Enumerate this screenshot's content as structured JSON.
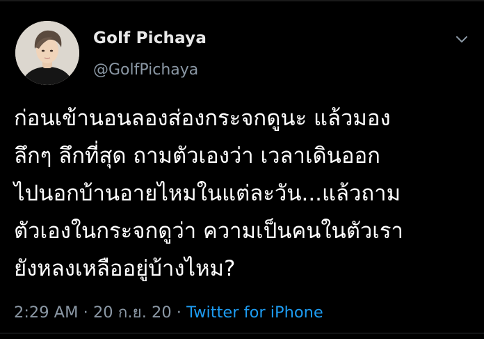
{
  "author": {
    "display_name": "Golf Pichaya",
    "handle": "@GolfPichaya",
    "avatar_icon": "profile-photo-icon"
  },
  "menu": {
    "icon": "chevron-down-icon"
  },
  "tweet": {
    "lines": [
      "ก่อนเข้านอนลองส่องกระจกดูนะ แล้วมอง",
      "ลึกๆ ลึกที่สุด ถามตัวเองว่า เวลาเดินออก",
      "ไปนอกบ้านอายไหมในแต่ละวัน...แล้วถาม",
      "ตัวเองในกระจกดูว่า ความเป็นคนในตัวเรา",
      "ยังหลงเหลืออยู่บ้างไหม?"
    ]
  },
  "meta": {
    "time": "2:29 AM",
    "separator": " · ",
    "date": "20 ก.ย. 20",
    "source": "Twitter for iPhone"
  },
  "colors": {
    "background": "#000000",
    "text": "#ffffff",
    "secondary": "#8b98a5",
    "link": "#1d9bf0"
  }
}
